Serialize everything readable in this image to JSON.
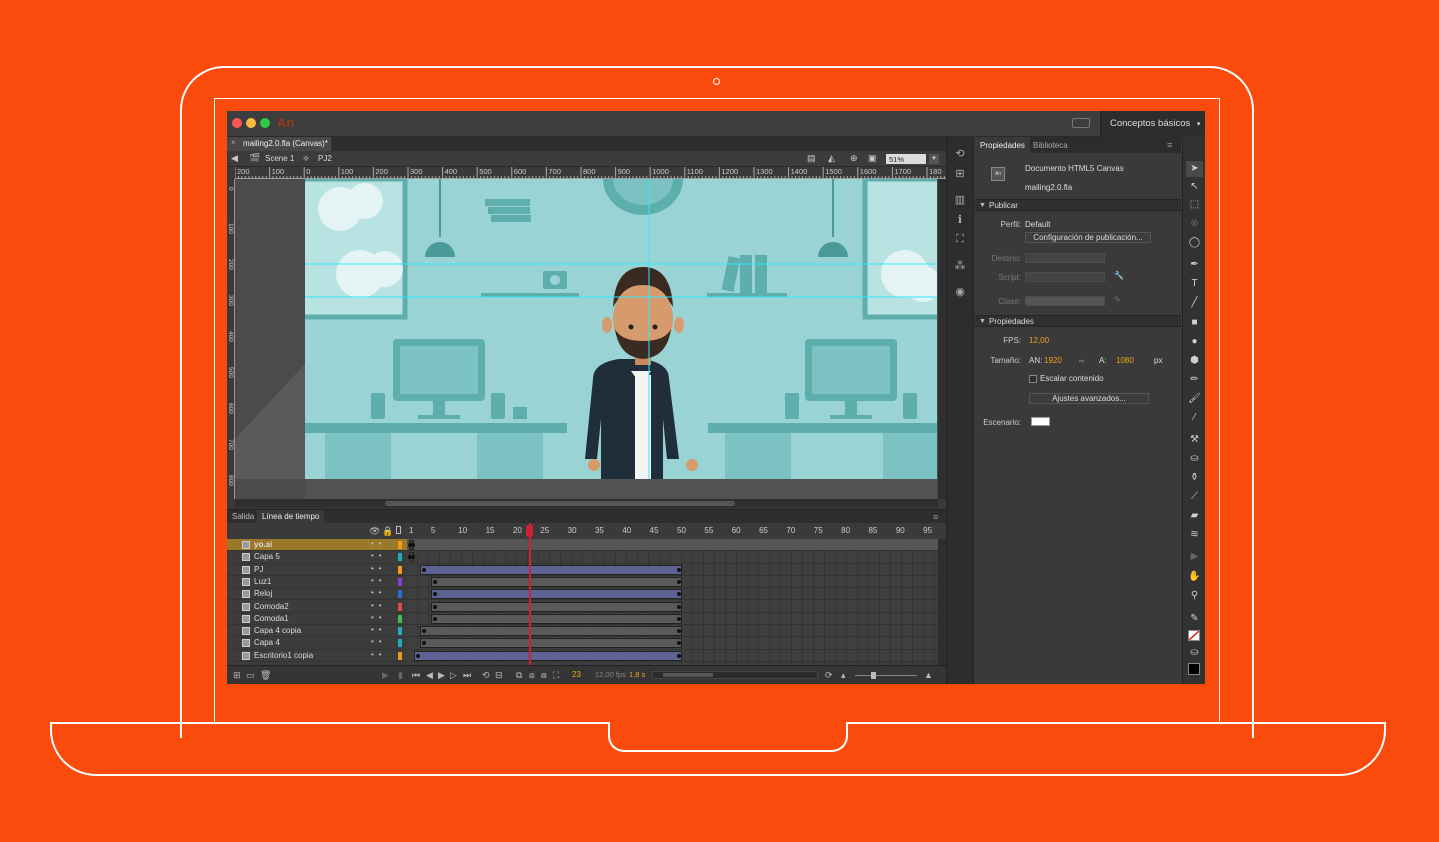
{
  "app": {
    "logo": "An",
    "workspace": "Conceptos básicos",
    "workspace_arrow": "▾",
    "lights": [
      "#fc5753",
      "#fdbc40",
      "#33c748"
    ]
  },
  "document": {
    "tab_label": "mailing2.0.fla (Canvas)*",
    "close": "×"
  },
  "editbar": {
    "scene": "Scene 1",
    "symbol": "PJ2",
    "zoom": "51%"
  },
  "rulers": {
    "h_ticks": [
      "200",
      "100",
      "0",
      "100",
      "200",
      "300",
      "400",
      "500",
      "600",
      "700",
      "800",
      "900",
      "1000",
      "1100",
      "1200",
      "1300",
      "1400",
      "1500",
      "1600",
      "1700",
      "180"
    ],
    "v_ticks": [
      "0",
      "100",
      "200",
      "300",
      "400",
      "500",
      "600",
      "700",
      "800"
    ]
  },
  "properties": {
    "tabs": [
      "Propiedades",
      "Biblioteca"
    ],
    "doc_type": "Documento HTML5 Canvas",
    "doc_name": "mailing2.0.fla",
    "publish_section": "Publicar",
    "profile_label": "Perfil:",
    "profile_value": "Default",
    "publish_settings_button": "Configuración de publicación...",
    "destino_label": "Destino:",
    "script_label": "Script:",
    "clase_label": "Clase:",
    "props_section": "Propiedades",
    "fps_label": "FPS:",
    "fps_value": "12,00",
    "size_label": "Tamaño:",
    "an_label": "AN:",
    "an_value": "1920",
    "a_label": "A:",
    "a_value": "1080",
    "unit": "px",
    "scale_content": "Escalar contenido",
    "advanced_button": "Ajustes avanzados...",
    "stage_label": "Escenario:",
    "stage_color": "#ffffff"
  },
  "timeline": {
    "tabs": [
      "Salida",
      "Línea de tiempo"
    ],
    "frame_numbers": [
      "1",
      "5",
      "10",
      "15",
      "20",
      "25",
      "30",
      "35",
      "40",
      "45",
      "50",
      "55",
      "60",
      "65",
      "70",
      "75",
      "80",
      "85",
      "90",
      "95"
    ],
    "current_frame": 23,
    "layers": [
      {
        "name": "yo.ai",
        "color": "#f09a20",
        "selected": true
      },
      {
        "name": "Capa 5",
        "color": "#2aa7b9"
      },
      {
        "name": "PJ",
        "color": "#f09a20"
      },
      {
        "name": "Luz1",
        "color": "#8a3fcf"
      },
      {
        "name": "Reloj",
        "color": "#2a6fd0"
      },
      {
        "name": "Comoda2",
        "color": "#e04b4b"
      },
      {
        "name": "Comoda1",
        "color": "#3fbf5a"
      },
      {
        "name": "Capa 4 copia",
        "color": "#2aa7b9"
      },
      {
        "name": "Capa 4",
        "color": "#2aa7b9"
      },
      {
        "name": "Escritorio1 copia",
        "color": "#f09a20"
      }
    ],
    "status_frame": "23",
    "status_fps": "12,00 fps",
    "status_time": "1,8 s"
  },
  "colors": {
    "background": "#fa4b0c",
    "stage": "#9ad3d3",
    "accent": "#f0a21e",
    "playhead": "#cc2233",
    "tween": "#5d6294"
  }
}
